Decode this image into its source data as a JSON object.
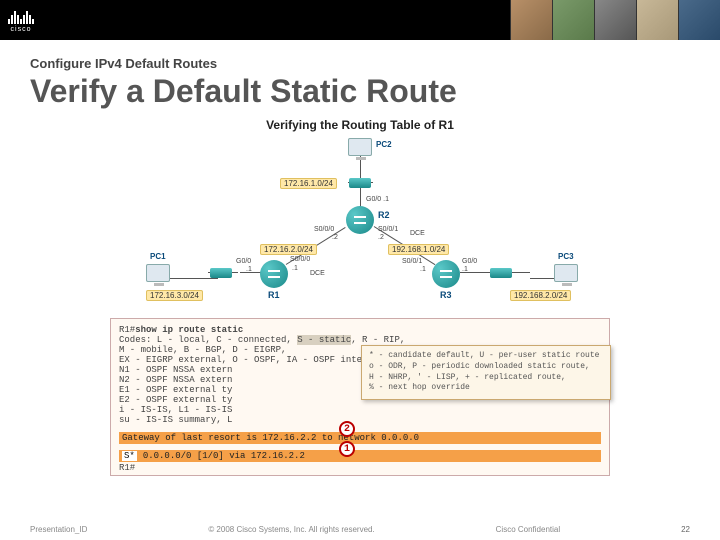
{
  "header": {
    "brand": "cisco"
  },
  "slide": {
    "breadcrumb": "Configure IPv4 Default Routes",
    "title": "Verify a Default Static Route"
  },
  "figure": {
    "title": "Verifying the Routing Table of R1",
    "devices": {
      "pc1": "PC1",
      "pc2": "PC2",
      "pc3": "PC3",
      "r1": "R1",
      "r2": "R2",
      "r3": "R3"
    },
    "nets": {
      "n1": "172.16.1.0/24",
      "n2": "172.16.2.0/24",
      "n3": "172.16.3.0/24",
      "n4": "192.168.1.0/24",
      "n5": "192.168.2.0/24"
    },
    "ifaces": {
      "r2_g00": "G0/0 .1",
      "r2_s000": "S0/0/0",
      "r2_s001": "S0/0/1",
      "r2_s000_ip": ".2",
      "r2_s001_ip": ".2",
      "dce": "DCE",
      "r1_g00": "G0/0",
      "r1_g00_ip": ".1",
      "r1_s000": "S0/0/0",
      "r1_s000_ip": ".1",
      "r3_s001": "S0/0/1",
      "r3_s001_ip": ".1",
      "r3_g00": "G0/0",
      "r3_g00_ip": ".1"
    }
  },
  "terminal": {
    "prompt": "R1#",
    "cmd": "show ip route static",
    "codes_head": "Codes: L - local, C - connected, ",
    "codes_s": "S - static",
    "codes_tail": ", R - RIP,",
    "line2": "       M - mobile, B - BGP, D - EIGRP,",
    "line3": "       EX - EIGRP external, O - OSPF, IA - OSPF inter area",
    "line4": "       N1 - OSPF NSSA extern",
    "line5": "       N2 - OSPF NSSA extern",
    "line6": "       E1 - OSPF external ty",
    "line7": "       E2 - OSPF external ty",
    "line8": "       i - IS-IS, L1 - IS-IS",
    "line9": "       su - IS-IS summary, L",
    "gw": "Gateway of last resort is 172.16.2.2 to network 0.0.0.0",
    "route_code": "S*",
    "route": "0.0.0.0/0 [1/0] via 172.16.2.2",
    "prompt2": "R1#"
  },
  "tooltip": {
    "t1": "* - candidate default, U - per-user static route",
    "t2": "o - ODR, P - periodic downloaded static route,",
    "t3": "H - NHRP, ' - LISP, + - replicated route,",
    "t4": "% - next hop override"
  },
  "callouts": {
    "c1": "1",
    "c2": "2"
  },
  "footer": {
    "left": "Presentation_ID",
    "center": "© 2008 Cisco Systems, Inc. All rights reserved.",
    "right": "Cisco Confidential",
    "page": "22"
  }
}
